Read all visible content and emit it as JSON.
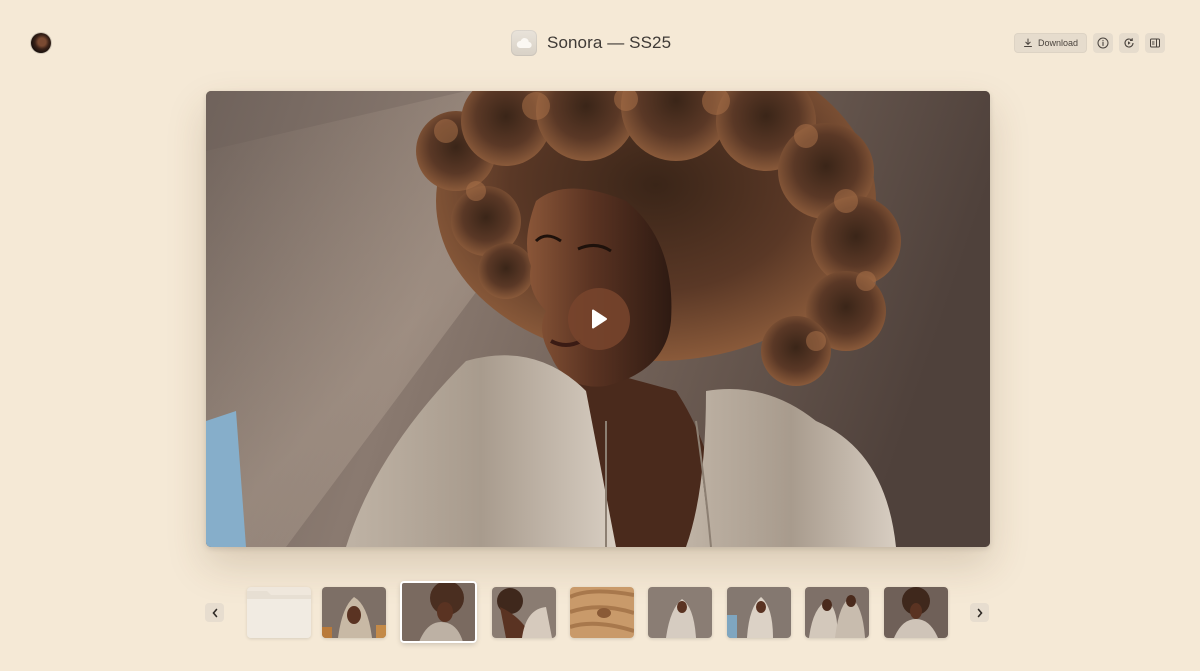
{
  "header": {
    "title": "Sonora — SS25",
    "download_label": "Download"
  },
  "icons": {
    "download": "download-icon",
    "info": "info-icon",
    "replay": "replay-icon",
    "panel": "sidebar-panel-icon",
    "play": "play-icon",
    "prev": "chevron-left-icon",
    "next": "chevron-right-icon"
  },
  "colors": {
    "background": "#f5e9d6",
    "play_button": "#7a442c",
    "button_bg": "#e6dccd"
  },
  "filmstrip": {
    "thumbnails": [
      {
        "kind": "folder"
      },
      {
        "kind": "hooded-figure"
      },
      {
        "kind": "portrait-curly-hair",
        "selected": true
      },
      {
        "kind": "figure-bent"
      },
      {
        "kind": "textile-closeup"
      },
      {
        "kind": "hooded-figure-seated"
      },
      {
        "kind": "hooded-figure-standing"
      },
      {
        "kind": "two-figures"
      },
      {
        "kind": "portrait-curly-hair-2"
      }
    ]
  }
}
